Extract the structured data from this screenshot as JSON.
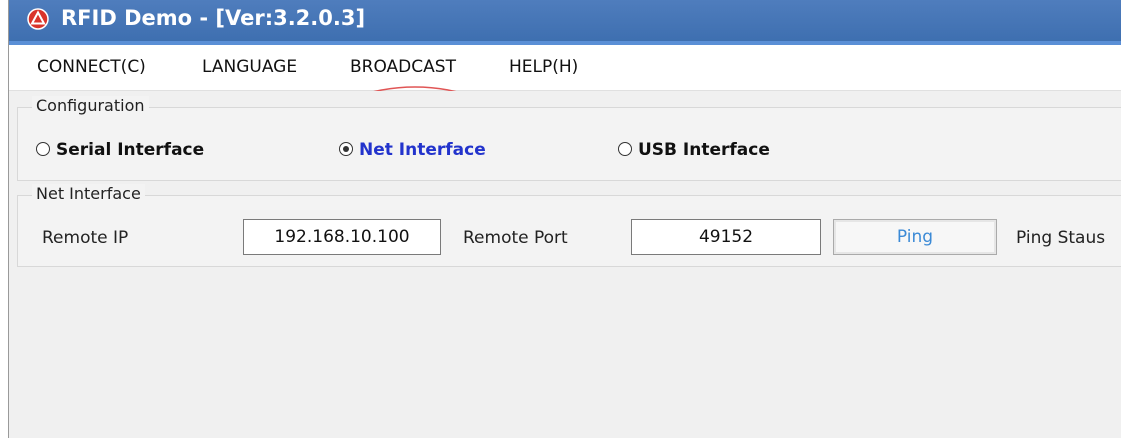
{
  "window": {
    "title": "RFID Demo - [Ver:3.2.0.3]",
    "title_bar_color": "#4174b6"
  },
  "menu": {
    "items": [
      "CONNECT(C)",
      "LANGUAGE",
      "BROADCAST",
      "HELP(H)"
    ]
  },
  "annotation": {
    "target": "BROADCAST",
    "shape": "ellipse",
    "color": "#e05555"
  },
  "configuration": {
    "legend": "Configuration",
    "options": [
      {
        "label": "Serial Interface",
        "selected": false
      },
      {
        "label": "Net Interface",
        "selected": true
      },
      {
        "label": "USB Interface",
        "selected": false
      }
    ]
  },
  "net": {
    "legend": "Net Interface",
    "remote_ip_label": "Remote IP",
    "remote_ip_value": "192.168.10.100",
    "remote_port_label": "Remote Port",
    "remote_port_value": "49152",
    "ping_button": "Ping",
    "ping_status_label": "Ping Staus"
  }
}
